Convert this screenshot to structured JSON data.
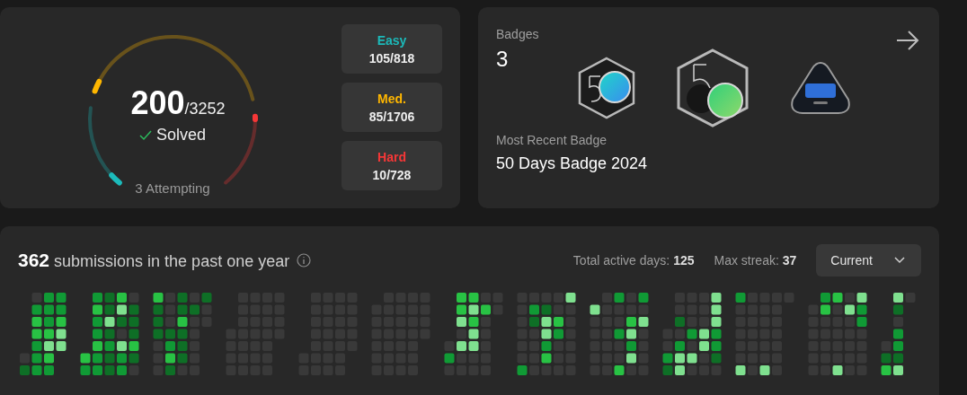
{
  "progress": {
    "solved": "200",
    "total": "/3252",
    "solved_label": "Solved",
    "attempting": "3 Attempting",
    "difficulties": [
      {
        "kind": "easy",
        "label": "Easy",
        "count": "105/818",
        "color": "#1cbaba"
      },
      {
        "kind": "medium",
        "label": "Med.",
        "count": "85/1706",
        "color": "#ffb700"
      },
      {
        "kind": "hard",
        "label": "Hard",
        "count": "10/728",
        "color": "#f63737"
      }
    ]
  },
  "badges": {
    "title": "Badges",
    "count": "3",
    "recent_label": "Most Recent Badge",
    "recent_name": "50 Days Badge 2024",
    "items": [
      {
        "kind": "days50-small"
      },
      {
        "kind": "days50-large"
      },
      {
        "kind": "pd"
      }
    ]
  },
  "submissions": {
    "summary": "**362** submissions in the past one year",
    "active_days": "Total active days: **125**",
    "max_streak": "Max streak: **37**",
    "dropdown": "Current"
  }
}
